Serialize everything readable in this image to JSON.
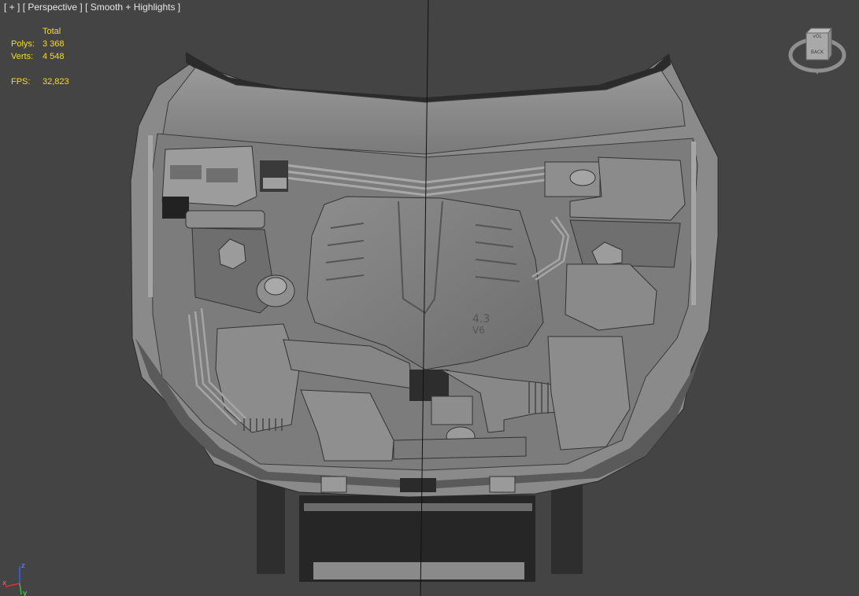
{
  "viewport": {
    "label_plus": "[ + ]",
    "label_view": "[ Perspective ]",
    "label_shading": "[ Smooth + Highlights ]"
  },
  "stats": {
    "column_header": "Total",
    "polys_label": "Polys:",
    "polys_value": "3 368",
    "verts_label": "Verts:",
    "verts_value": "4 548",
    "fps_label": "FPS:",
    "fps_value": "32,823"
  },
  "viewcube": {
    "top_face": "vOL",
    "front_face": "BACK"
  },
  "axes": {
    "z": "z",
    "x": "x",
    "y": "y"
  },
  "model_decal": {
    "line1": "4.3",
    "line2": "V6"
  },
  "colors": {
    "background": "#444444",
    "stats_text": "#f2dc2a",
    "label_text": "#e6e6e6",
    "axis_x": "#e03030",
    "axis_y": "#30c030",
    "axis_z": "#3060ff"
  }
}
